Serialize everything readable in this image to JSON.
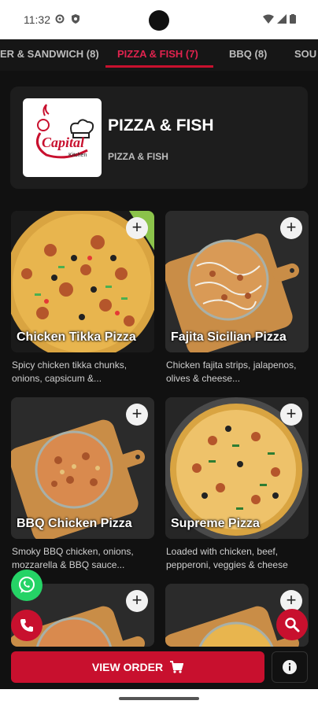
{
  "status_bar": {
    "time": "11:32",
    "icons": [
      "settings-icon",
      "shield-icon",
      "wifi-icon",
      "signal-icon",
      "battery-icon"
    ]
  },
  "tabs": [
    {
      "label": "ER & SANDWICH (8)",
      "active": false
    },
    {
      "label": "PIZZA & FISH (7)",
      "active": true
    },
    {
      "label": "BBQ (8)",
      "active": false
    },
    {
      "label": "SOU",
      "active": false
    }
  ],
  "category": {
    "title": "PIZZA & FISH",
    "subtitle": "PIZZA & FISH",
    "logo_text": "Capital",
    "logo_subtext": "Kitchen"
  },
  "items": [
    {
      "name": "Chicken Tikka Pizza",
      "description": "Spicy chicken tikka chunks, onions, capsicum &...",
      "add_symbol": "+"
    },
    {
      "name": "Fajita Sicilian Pizza",
      "description": "Chicken fajita strips, jalapenos, olives & cheese...",
      "add_symbol": "+"
    },
    {
      "name": "BBQ Chicken Pizza",
      "description": "Smoky BBQ chicken, onions, mozzarella & BBQ sauce...",
      "add_symbol": "+"
    },
    {
      "name": "Supreme Pizza",
      "description": "Loaded with chicken, beef, pepperoni, veggies & cheese",
      "add_symbol": "+"
    },
    {
      "name": "",
      "description": "",
      "add_symbol": "+"
    },
    {
      "name": "",
      "description": "",
      "add_symbol": "+"
    }
  ],
  "bottom_bar": {
    "view_order_label": "VIEW ORDER"
  },
  "colors": {
    "accent": "#c8102e",
    "active_tab": "#e0234e",
    "background": "#111111",
    "card": "#1d1d1d",
    "whatsapp": "#25d366"
  }
}
